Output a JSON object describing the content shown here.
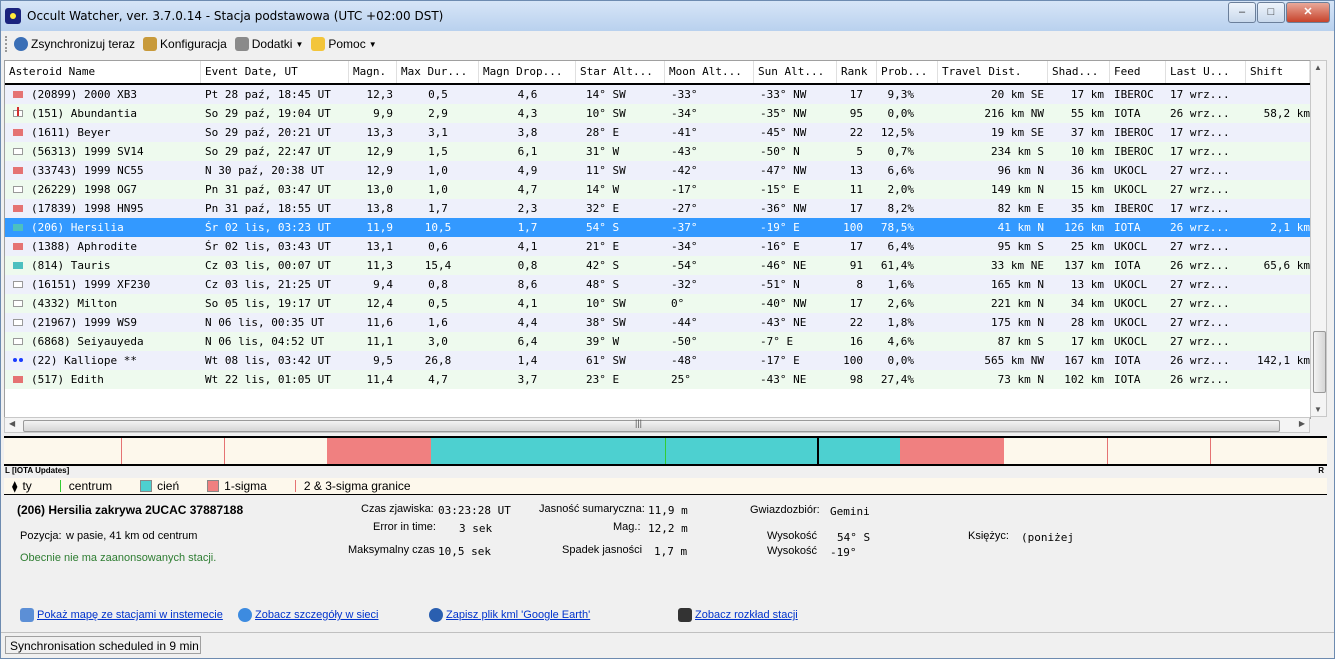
{
  "window": {
    "title": "Occult Watcher, ver. 3.7.0.14 - Stacja podstawowa (UTC +02:00 DST)",
    "buttons": {
      "minimize": "–",
      "maximize": "□",
      "close": "✕"
    }
  },
  "toolbar": {
    "sync_label": "Zsynchronizuj teraz",
    "config_label": "Konfiguracja",
    "addons_label": "Dodatki",
    "help_label": "Pomoc"
  },
  "columns": [
    "Asteroid Name",
    "Event Date, UT",
    "Magn.",
    "Max Dur...",
    "Magn Drop...",
    "Star Alt...",
    "Moon Alt...",
    "Sun Alt...",
    "Rank",
    "Prob...",
    "Travel Dist.",
    "Shad...",
    "Feed",
    "Last U...",
    "Shift"
  ],
  "rows": [
    {
      "marker": "red",
      "name": "(20899) 2000 XB3",
      "date": "Pt 28 paź, 18:45 UT",
      "magn": "12,3",
      "dur": "0,5",
      "drop": "4,6",
      "star": "14° SW",
      "moon": "-33°",
      "sun": "-33° NW",
      "rank": "17",
      "prob": "9,3%",
      "travel": "20 km SE",
      "shad": "17 km",
      "feed": "IBEROC",
      "last": "17 wrz...",
      "shift": ""
    },
    {
      "marker": "redup",
      "name": "(151) Abundantia",
      "date": "So 29 paź, 19:04 UT",
      "magn": "9,9",
      "dur": "2,9",
      "drop": "4,3",
      "star": "10° SW",
      "moon": "-34°",
      "sun": "-35° NW",
      "rank": "95",
      "prob": "0,0%",
      "travel": "216 km NW",
      "shad": "55 km",
      "feed": "IOTA",
      "last": "26 wrz...",
      "shift": "58,2 km"
    },
    {
      "marker": "red",
      "name": "(1611) Beyer",
      "date": "So 29 paź, 20:21 UT",
      "magn": "13,3",
      "dur": "3,1",
      "drop": "3,8",
      "star": "28° E",
      "moon": "-41°",
      "sun": "-45° NW",
      "rank": "22",
      "prob": "12,5%",
      "travel": "19 km SE",
      "shad": "37 km",
      "feed": "IBEROC",
      "last": "17 wrz...",
      "shift": ""
    },
    {
      "marker": "white",
      "name": "(56313) 1999 SV14",
      "date": "So 29 paź, 22:47 UT",
      "magn": "12,9",
      "dur": "1,5",
      "drop": "6,1",
      "star": "31° W",
      "moon": "-43°",
      "sun": "-50° N",
      "rank": "5",
      "prob": "0,7%",
      "travel": "234 km S",
      "shad": "10 km",
      "feed": "IBEROC",
      "last": "17 wrz...",
      "shift": ""
    },
    {
      "marker": "red",
      "name": "(33743) 1999 NC55",
      "date": "N 30 paź, 20:38 UT",
      "magn": "12,9",
      "dur": "1,0",
      "drop": "4,9",
      "star": "11° SW",
      "moon": "-42°",
      "sun": "-47° NW",
      "rank": "13",
      "prob": "6,6%",
      "travel": "96 km N",
      "shad": "36 km",
      "feed": "UKOCL",
      "last": "27 wrz...",
      "shift": ""
    },
    {
      "marker": "white",
      "name": "(26229) 1998 OG7",
      "date": "Pn 31 paź, 03:47 UT",
      "magn": "13,0",
      "dur": "1,0",
      "drop": "4,7",
      "star": "14° W",
      "moon": "-17°",
      "sun": "-15° E",
      "rank": "11",
      "prob": "2,0%",
      "travel": "149 km N",
      "shad": "15 km",
      "feed": "UKOCL",
      "last": "27 wrz...",
      "shift": ""
    },
    {
      "marker": "red",
      "name": "(17839) 1998 HN95",
      "date": "Pn 31 paź, 18:55 UT",
      "magn": "13,8",
      "dur": "1,7",
      "drop": "2,3",
      "star": "32° E",
      "moon": "-27°",
      "sun": "-36° NW",
      "rank": "17",
      "prob": "8,2%",
      "travel": "82 km E",
      "shad": "35 km",
      "feed": "IBEROC",
      "last": "17 wrz...",
      "shift": ""
    },
    {
      "marker": "teal",
      "name": "(206) Hersilia",
      "date": "Śr 02 lis, 03:23 UT",
      "magn": "11,9",
      "dur": "10,5",
      "drop": "1,7",
      "star": "54° S",
      "moon": "-37°",
      "sun": "-19° E",
      "rank": "100",
      "prob": "78,5%",
      "travel": "41 km N",
      "shad": "126 km",
      "feed": "IOTA",
      "last": "26 wrz...",
      "shift": "2,1 km",
      "selected": true
    },
    {
      "marker": "red",
      "name": "(1388) Aphrodite",
      "date": "Śr 02 lis, 03:43 UT",
      "magn": "13,1",
      "dur": "0,6",
      "drop": "4,1",
      "star": "21° E",
      "moon": "-34°",
      "sun": "-16° E",
      "rank": "17",
      "prob": "6,4%",
      "travel": "95 km S",
      "shad": "25 km",
      "feed": "UKOCL",
      "last": "27 wrz...",
      "shift": ""
    },
    {
      "marker": "teal",
      "name": "(814) Tauris",
      "date": "Cz 03 lis, 00:07 UT",
      "magn": "11,3",
      "dur": "15,4",
      "drop": "0,8",
      "star": "42° S",
      "moon": "-54°",
      "sun": "-46° NE",
      "rank": "91",
      "prob": "61,4%",
      "travel": "33 km NE",
      "shad": "137 km",
      "feed": "IOTA",
      "last": "26 wrz...",
      "shift": "65,6 km"
    },
    {
      "marker": "white",
      "name": "(16151) 1999 XF230",
      "date": "Cz 03 lis, 21:25 UT",
      "magn": "9,4",
      "dur": "0,8",
      "drop": "8,6",
      "star": "48° S",
      "moon": "-32°",
      "sun": "-51° N",
      "rank": "8",
      "prob": "1,6%",
      "travel": "165 km N",
      "shad": "13 km",
      "feed": "UKOCL",
      "last": "27 wrz...",
      "shift": ""
    },
    {
      "marker": "white",
      "name": "(4332) Milton",
      "date": "So 05 lis, 19:17 UT",
      "magn": "12,4",
      "dur": "0,5",
      "drop": "4,1",
      "star": "10° SW",
      "moon": "0°",
      "sun": "-40° NW",
      "rank": "17",
      "prob": "2,6%",
      "travel": "221 km N",
      "shad": "34 km",
      "feed": "UKOCL",
      "last": "27 wrz...",
      "shift": ""
    },
    {
      "marker": "white",
      "name": "(21967) 1999 WS9",
      "date": "N 06 lis, 00:35 UT",
      "magn": "11,6",
      "dur": "1,6",
      "drop": "4,4",
      "star": "38° SW",
      "moon": "-44°",
      "sun": "-43° NE",
      "rank": "22",
      "prob": "1,8%",
      "travel": "175 km N",
      "shad": "28 km",
      "feed": "UKOCL",
      "last": "27 wrz...",
      "shift": ""
    },
    {
      "marker": "white",
      "name": "(6868) Seiyauyeda",
      "date": "N 06 lis, 04:52 UT",
      "magn": "11,1",
      "dur": "3,0",
      "drop": "6,4",
      "star": "39° W",
      "moon": "-50°",
      "sun": "-7° E",
      "rank": "16",
      "prob": "4,6%",
      "travel": "87 km S",
      "shad": "17 km",
      "feed": "UKOCL",
      "last": "27 wrz...",
      "shift": ""
    },
    {
      "marker": "dots",
      "name": "(22) Kalliope **",
      "date": "Wt 08 lis, 03:42 UT",
      "magn": "9,5",
      "dur": "26,8",
      "drop": "1,4",
      "star": "61° SW",
      "moon": "-48°",
      "sun": "-17° E",
      "rank": "100",
      "prob": "0,0%",
      "travel": "565 km NW",
      "shad": "167 km",
      "feed": "IOTA",
      "last": "26 wrz...",
      "shift": "142,1 km"
    },
    {
      "marker": "red",
      "name": "(517) Edith",
      "date": "Wt 22 lis, 01:05 UT",
      "magn": "11,4",
      "dur": "4,7",
      "drop": "3,7",
      "star": "23° E",
      "moon": "25°",
      "sun": "-43° NE",
      "rank": "98",
      "prob": "27,4%",
      "travel": "73 km N",
      "shad": "102 km",
      "feed": "IOTA",
      "last": "26 wrz...",
      "shift": ""
    }
  ],
  "scroll_grip": "|||",
  "band": {
    "left_label": "L [IOTA Updates]",
    "right_label": "R"
  },
  "legend": {
    "you": "ty",
    "center": "centrum",
    "shadow": "cień",
    "sigma1": "1-sigma",
    "sigma23": "2 & 3-sigma granice"
  },
  "colors": {
    "sigma": "#e57373",
    "shadow": "#4dd0d0",
    "center": "#33cc33",
    "selection": "#3399ff",
    "row_even": "#eef0fb",
    "row_odd": "#eefaee"
  },
  "details": {
    "title": "(206) Hersilia zakrywa 2UCAC 37887188",
    "position_label": "Pozycja:",
    "position_value": "w pasie, 41 km od centrum",
    "no_stations": "Obecnie nie ma zaanonsowanych stacji.",
    "time_label": "Czas zjawiska:",
    "time_value": "03:23:28 UT",
    "error_label": "Error in time:",
    "error_value": "3 sek",
    "maxtime_label": "Maksymalny czas",
    "maxtime_value": "10,5 sek",
    "combined_label": "Jasność sumaryczna:",
    "combined_value": "11,9 m",
    "mag_label": "Mag.:",
    "mag_value": "12,2 m",
    "drop_label": "Spadek jasności",
    "drop_value": "1,7 m",
    "constellation_label": "Gwiazdozbiór:",
    "constellation_value": "Gemini",
    "alt1_label": "Wysokość",
    "alt1_value": "54° S",
    "alt2_label": "Wysokość",
    "alt2_value": "-19°",
    "moon_label": "Księżyc:",
    "moon_value": "(poniżej"
  },
  "links": {
    "map": "Pokaż mapę ze stacjami w instemecie",
    "web": "Zobacz szczegóły w sieci",
    "kml": "Zapisz plik kml 'Google Earth'",
    "stations": "Zobacz rozkład stacji"
  },
  "status": "Synchronisation scheduled in 9 min"
}
